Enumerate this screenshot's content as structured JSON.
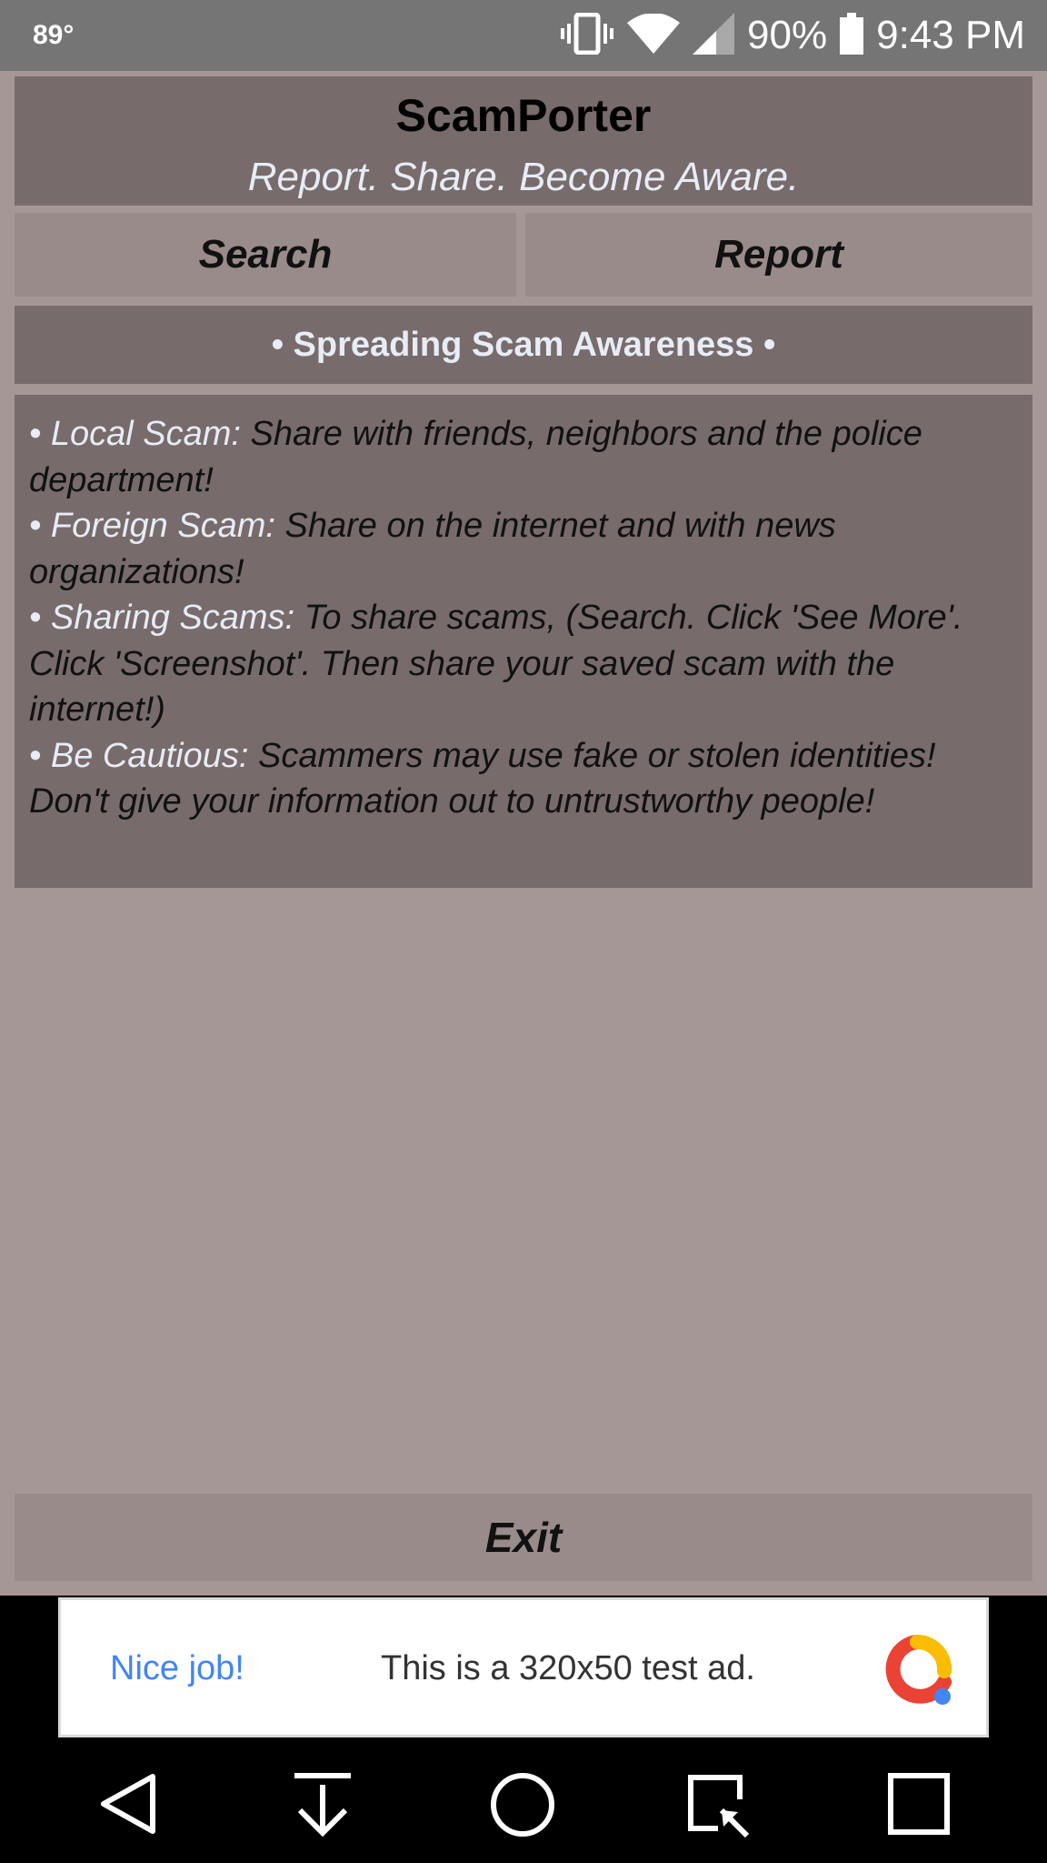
{
  "status_bar": {
    "temperature": "89°",
    "battery_percent": "90%",
    "time": "9:43 PM",
    "icons": [
      "vibrate-icon",
      "wifi-icon",
      "signal-icon",
      "battery-icon"
    ]
  },
  "app": {
    "title": "ScamPorter",
    "tagline": "Report. Share. Become Aware.",
    "nav": {
      "search_label": "Search",
      "report_label": "Report"
    },
    "banner": "• Spreading Scam Awareness •",
    "tips": [
      {
        "label": "• Local Scam:",
        "text": " Share with friends, neighbors and the police department!"
      },
      {
        "label": "• Foreign Scam:",
        "text": " Share on the internet and with news organizations!"
      },
      {
        "label": "• Sharing Scams:",
        "text": " To share scams, (Search. Click 'See More'. Click 'Screenshot'. Then share your saved scam with the internet!)"
      },
      {
        "label": "• Be Cautious:",
        "text": " Scammers may use fake or stolen identities! Don't give your information out to untrustworthy people!"
      }
    ],
    "exit_label": "Exit"
  },
  "ad": {
    "nice_job": "Nice job!",
    "text": "This is a 320x50 test ad."
  },
  "colors": {
    "status_bar": "#757575",
    "background": "#a69797",
    "panel_dark": "#776b6b",
    "button": "#9a8b8b",
    "accent_text": "#e7ecf6",
    "ad_link": "#4285f4"
  }
}
